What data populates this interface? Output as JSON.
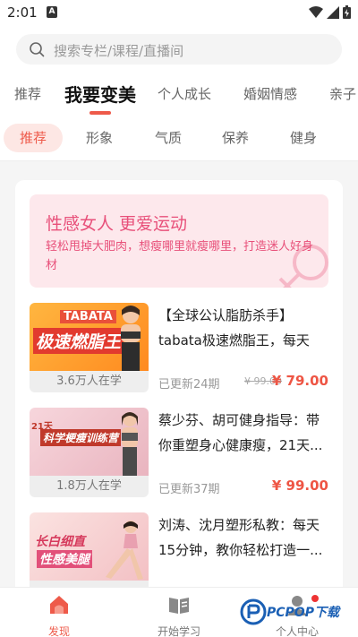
{
  "status": {
    "time": "2:01",
    "notif_letter": "A"
  },
  "search": {
    "placeholder": "搜索专栏/课程/直播间"
  },
  "main_tabs": [
    "推荐",
    "我要变美",
    "个人成长",
    "婚姻情感",
    "亲子"
  ],
  "sub_tabs": [
    "推荐",
    "形象",
    "气质",
    "保养",
    "健身"
  ],
  "banner": {
    "title": "性感女人 更爱运动",
    "subtitle": "轻松甩掉大肥肉，想瘦哪里就瘦哪里，打造迷人好身材"
  },
  "courses": [
    {
      "title": "【全球公认脂肪杀手】tabata极速燃脂王，每天4...",
      "learners": "3.6万人在学",
      "updated": "已更新24期",
      "old_price": "¥ 99.00",
      "price": "¥ 79.00",
      "thumb_top": "TABATA",
      "thumb_main": "极速燃脂王"
    },
    {
      "title": "蔡少芬、胡可健身指导：带你重塑身心健康瘦，21天...",
      "learners": "1.8万人在学",
      "updated": "已更新37期",
      "old_price": "",
      "price": "¥ 99.00",
      "thumb_top": "21天",
      "thumb_main": "科学梗瘦训练营"
    },
    {
      "title": "刘涛、沈月塑形私教：每天15分钟，教你轻松打造一...",
      "learners": "",
      "updated": "",
      "old_price": "",
      "price": "",
      "thumb_top": "长白细直",
      "thumb_main": "性感美腿"
    }
  ],
  "bottom_nav": [
    "发现",
    "开始学习",
    "个人中心"
  ],
  "watermark": {
    "text": "PCPOP下载"
  },
  "colors": {
    "accent": "#ee5a4a",
    "pink": "#e8507a",
    "price": "#ee4433"
  }
}
